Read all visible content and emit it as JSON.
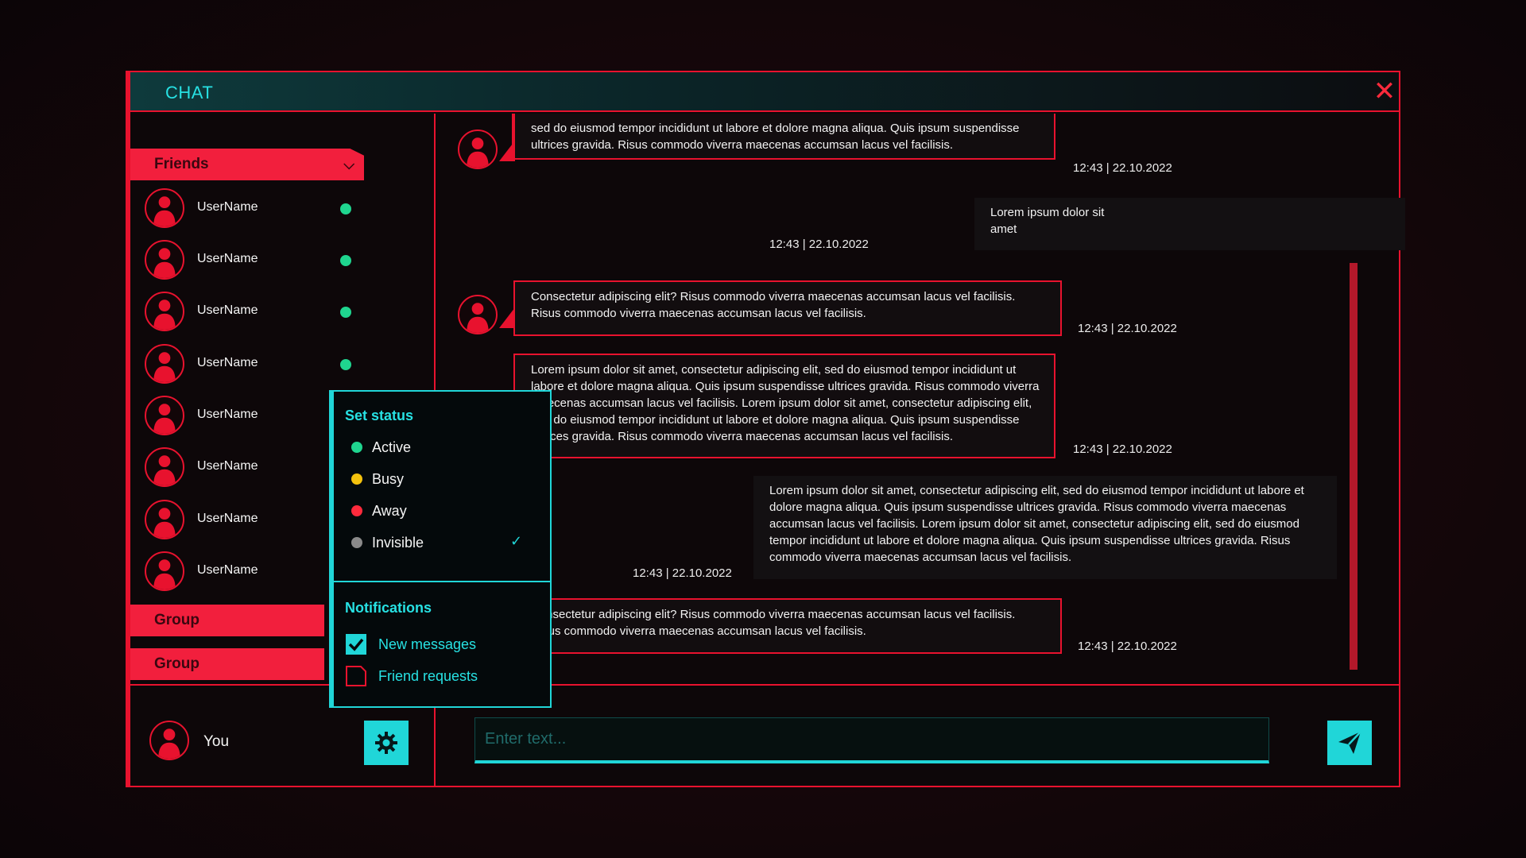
{
  "window": {
    "title": "CHAT",
    "close_icon": "close-icon"
  },
  "colors": {
    "accent_red": "#e8122e",
    "accent_cyan": "#20d6d8",
    "online": "#1fd58f",
    "busy": "#f4c20d",
    "away": "#ff2a3c",
    "invisible": "#8a8a8a"
  },
  "sidebar": {
    "friends_label": "Friends",
    "friends": [
      {
        "name": "UserName",
        "status": "online"
      },
      {
        "name": "UserName",
        "status": "online"
      },
      {
        "name": "UserName",
        "status": "online"
      },
      {
        "name": "UserName",
        "status": "online"
      },
      {
        "name": "UserName",
        "status": "online"
      },
      {
        "name": "UserName",
        "status": "online"
      },
      {
        "name": "UserName",
        "status": "online"
      },
      {
        "name": "UserName",
        "status": "online"
      }
    ],
    "groups": [
      "Group",
      "Group"
    ],
    "me": {
      "name": "You"
    }
  },
  "messages": [
    {
      "text": "sed do eiusmod tempor incididunt ut labore et dolore magna aliqua. Quis ipsum suspendisse ultrices gravida. Risus commodo viverra maecenas accumsan lacus vel facilisis.",
      "time": "12:43 | 22.10.2022"
    },
    {
      "text": "Lorem ipsum dolor sit amet",
      "time": "12:43 | 22.10.2022"
    },
    {
      "text": "Consectetur adipiscing elit? Risus commodo viverra maecenas accumsan lacus vel facilisis. Risus commodo viverra maecenas accumsan lacus vel facilisis.",
      "time": "12:43 | 22.10.2022"
    },
    {
      "text": "Lorem ipsum dolor sit amet, consectetur adipiscing elit, sed do eiusmod tempor incididunt ut labore et dolore magna aliqua. Quis ipsum suspendisse ultrices gravida. Risus commodo viverra maecenas accumsan lacus vel facilisis. Lorem ipsum dolor sit amet, consectetur adipiscing elit, sed do eiusmod tempor incididunt ut labore et dolore magna aliqua. Quis ipsum suspendisse ultrices gravida. Risus commodo viverra maecenas accumsan lacus vel facilisis.",
      "time": "12:43 | 22.10.2022"
    },
    {
      "text": "Lorem ipsum dolor sit amet, consectetur adipiscing elit, sed do eiusmod tempor incididunt ut labore et dolore magna aliqua. Quis ipsum suspendisse ultrices gravida. Risus commodo viverra maecenas accumsan lacus vel facilisis. Lorem ipsum dolor sit amet, consectetur adipiscing elit, sed do eiusmod tempor incididunt ut labore et dolore magna aliqua. Quis ipsum suspendisse ultrices gravida. Risus commodo viverra maecenas accumsan lacus vel facilisis.",
      "time": "12:43 | 22.10.2022"
    },
    {
      "text": "Consectetur adipiscing elit? Risus commodo viverra maecenas accumsan lacus vel facilisis. Risus commodo viverra maecenas accumsan lacus vel facilisis.",
      "time": "12:43 | 22.10.2022"
    }
  ],
  "input": {
    "placeholder": "Enter text..."
  },
  "status_menu": {
    "heading": "Set status",
    "options": [
      {
        "label": "Active",
        "color": "#1fd58f",
        "selected": false
      },
      {
        "label": "Busy",
        "color": "#f4c20d",
        "selected": false
      },
      {
        "label": "Away",
        "color": "#ff2a3c",
        "selected": false
      },
      {
        "label": "Invisible",
        "color": "#8a8a8a",
        "selected": true
      }
    ],
    "notifications_heading": "Notifications",
    "notifications": [
      {
        "label": "New messages",
        "checked": true
      },
      {
        "label": "Friend requests",
        "checked": false
      }
    ]
  }
}
